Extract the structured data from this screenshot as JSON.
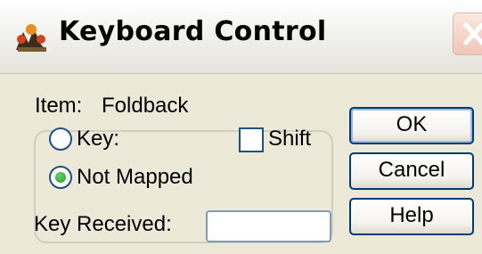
{
  "window": {
    "title": "Keyboard Control",
    "close_icon": "close-icon"
  },
  "item": {
    "label": "Item:",
    "value": "Foldback"
  },
  "mapping": {
    "key_option_label": "Key:",
    "not_mapped_option_label": "Not Mapped",
    "selected": "Not Mapped",
    "shift_label": "Shift",
    "shift_checked": false
  },
  "key_received": {
    "label": "Key Received:",
    "value": ""
  },
  "buttons": {
    "ok": "OK",
    "cancel": "Cancel",
    "help": "Help"
  },
  "colors": {
    "dialog_bg": "#ece9d8",
    "button_border": "#003c74",
    "close_button": "#f0c6b6"
  }
}
